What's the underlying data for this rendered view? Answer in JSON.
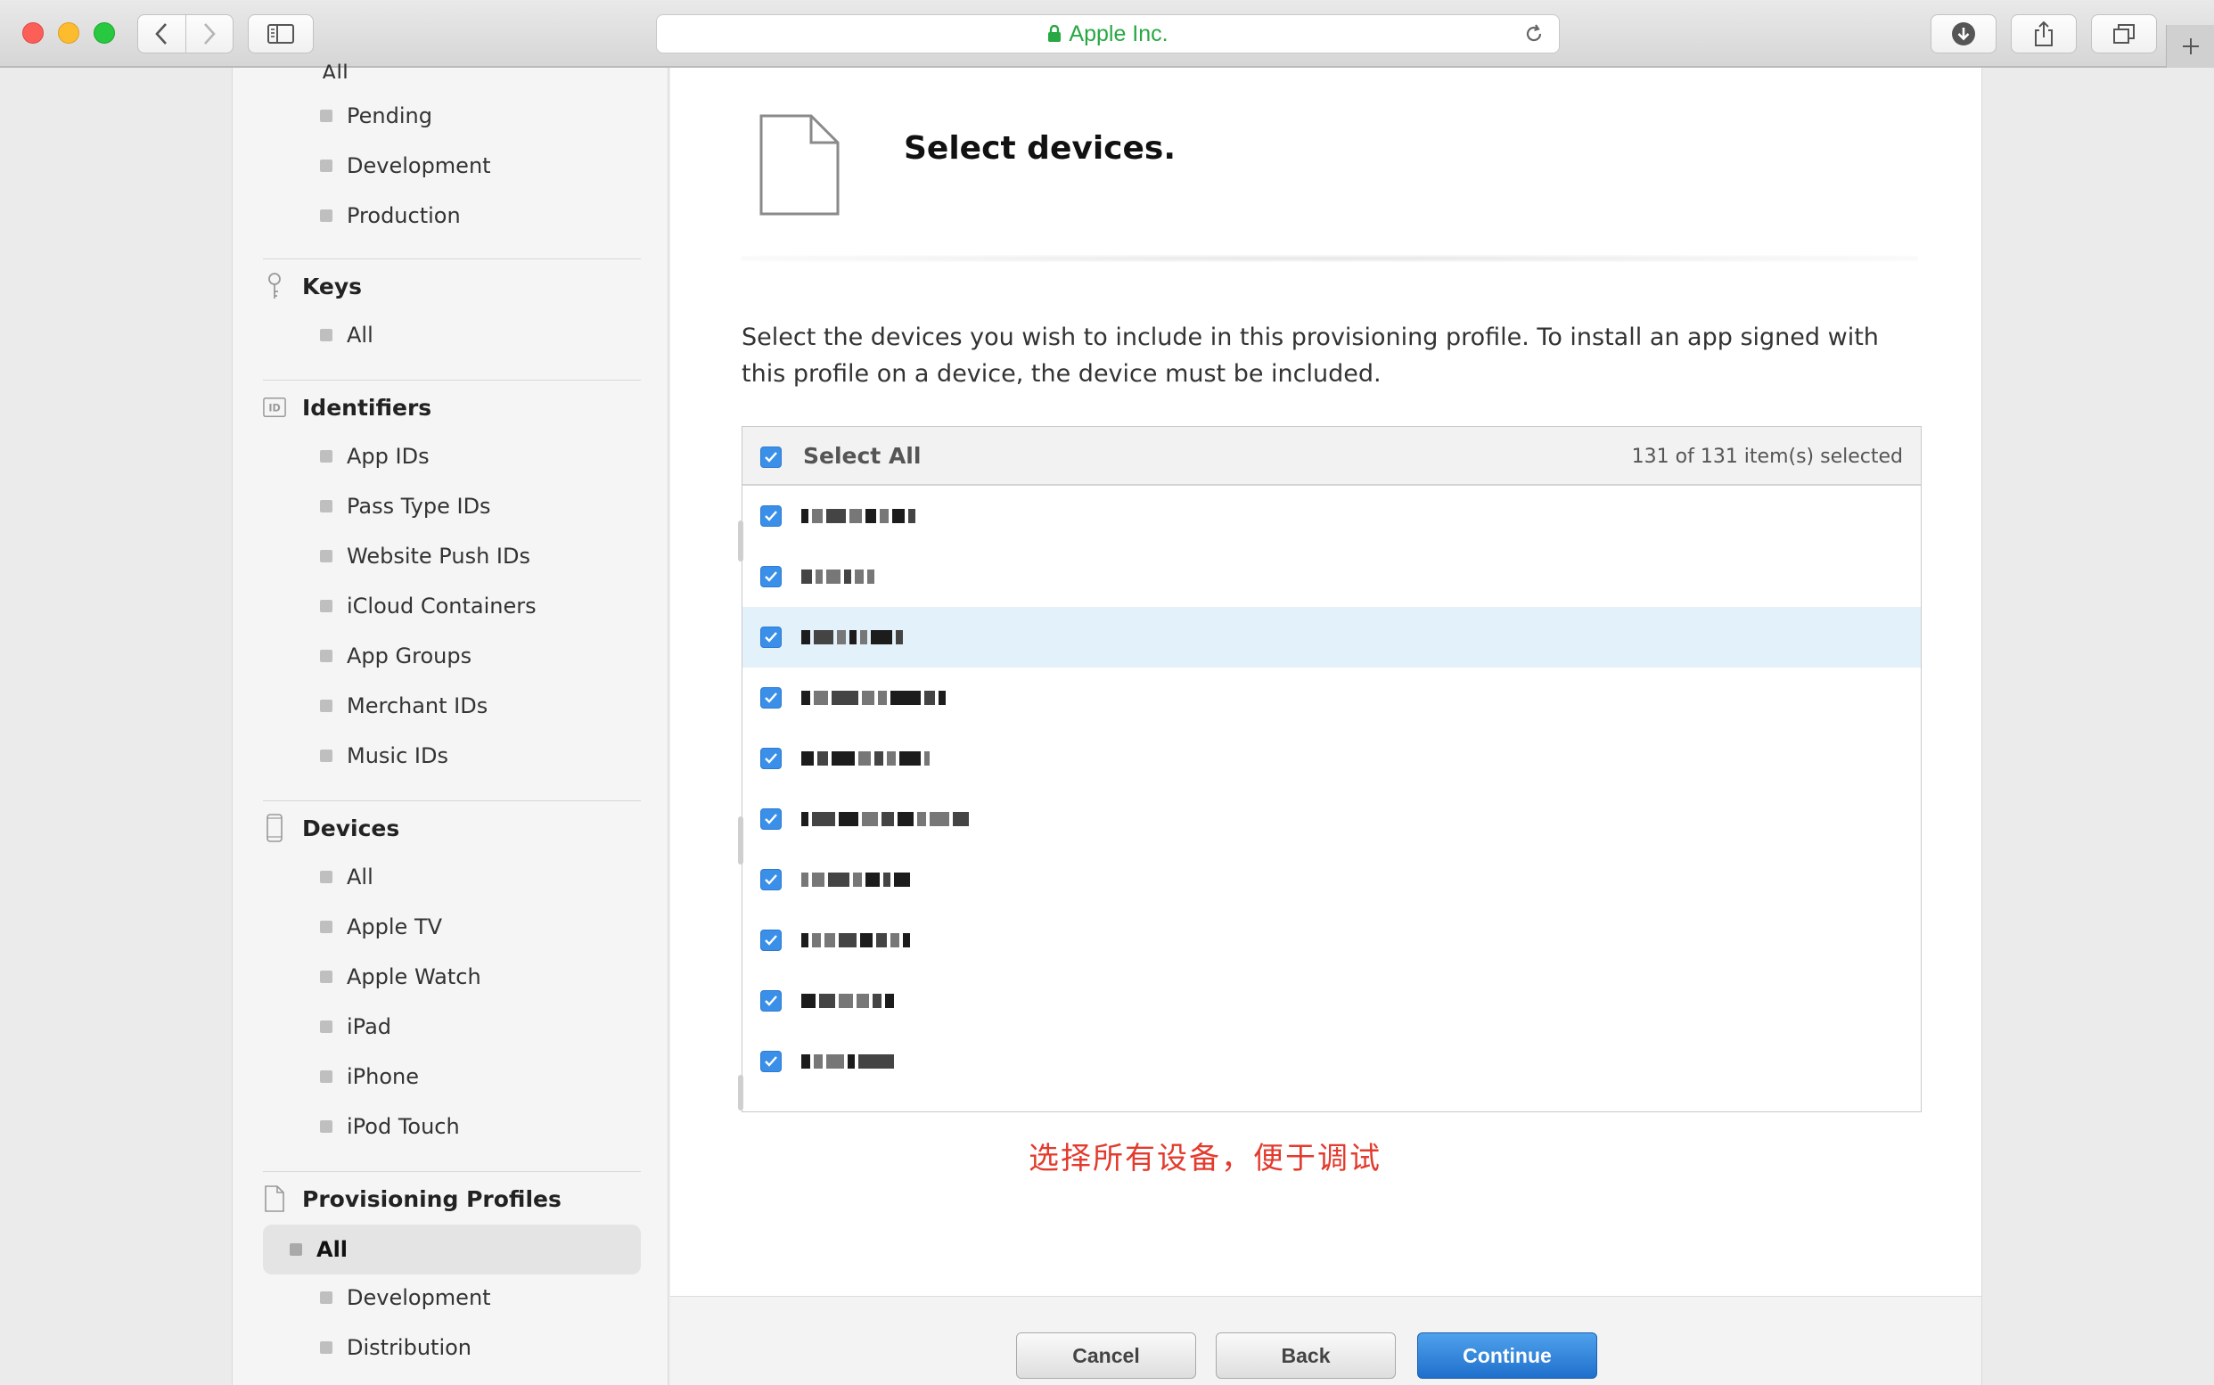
{
  "browser": {
    "address_text": "Apple Inc."
  },
  "sidebar": {
    "cut_item": "All",
    "sections": [
      {
        "items": [
          "Pending",
          "Development",
          "Production"
        ]
      },
      {
        "title": "Keys",
        "icon": "key-icon",
        "items": [
          "All"
        ]
      },
      {
        "title": "Identifiers",
        "icon": "id-icon",
        "items": [
          "App IDs",
          "Pass Type IDs",
          "Website Push IDs",
          "iCloud Containers",
          "App Groups",
          "Merchant IDs",
          "Music IDs"
        ]
      },
      {
        "title": "Devices",
        "icon": "phone-icon",
        "items": [
          "All",
          "Apple TV",
          "Apple Watch",
          "iPad",
          "iPhone",
          "iPod Touch"
        ]
      },
      {
        "title": "Provisioning Profiles",
        "icon": "document-icon",
        "items": [
          "All",
          "Development",
          "Distribution"
        ],
        "selected": "All"
      }
    ]
  },
  "main": {
    "title": "Select devices.",
    "intro": "Select the devices you wish to include in this provisioning profile. To install an app signed with this profile on a device, the device must be included.",
    "select_all_label": "Select All",
    "count_text": "131   of 131 item(s) selected",
    "annotation": "选择所有设备，便于调试",
    "accent_color": "#3a8fe8",
    "rows_checked": [
      true,
      true,
      true,
      true,
      true,
      true,
      true,
      true,
      true,
      true
    ],
    "highlighted_row": 2
  },
  "footer": {
    "cancel_label": "Cancel",
    "back_label": "Back",
    "continue_label": "Continue"
  }
}
